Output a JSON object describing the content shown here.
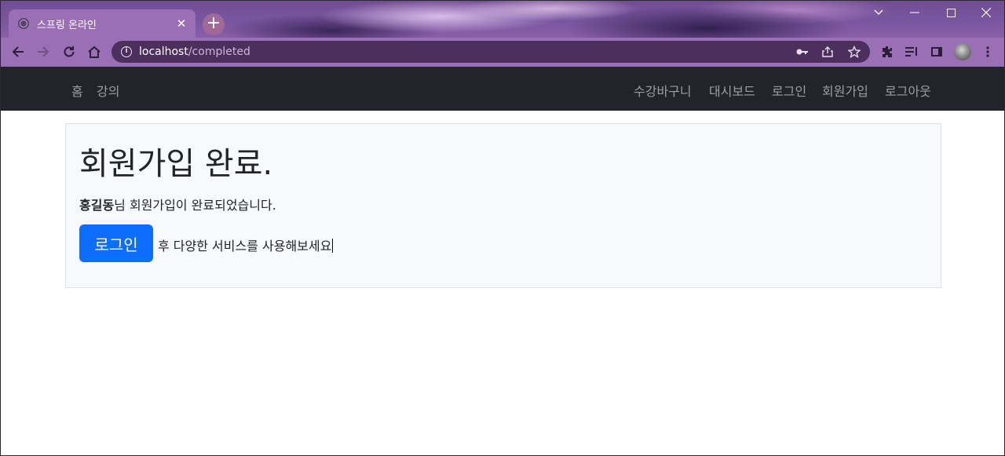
{
  "browser": {
    "tab_title": "스프링 온라인",
    "url_host": "localhost",
    "url_path": "/completed",
    "theme_color": "#9a6fb6"
  },
  "nav": {
    "left": [
      "홈",
      "강의"
    ],
    "right": [
      "수강바구니",
      "대시보드",
      "로그인",
      "회원가입",
      "로그아웃"
    ]
  },
  "main": {
    "title": "회원가입 완료.",
    "user_name": "홍길동",
    "message_suffix": "님 회원가입이 완료되었습니다.",
    "login_button": "로그인",
    "after_button_text": "후 다양한 서비스를 사용해보세요",
    "button_color": "#0d6efd"
  }
}
